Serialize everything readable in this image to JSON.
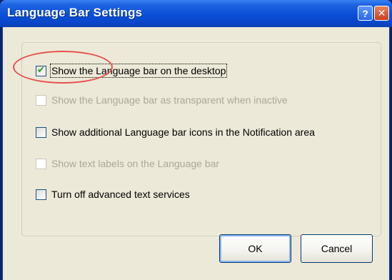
{
  "window": {
    "title": "Language Bar Settings",
    "help_label": "?",
    "close_label": "✕"
  },
  "options": [
    {
      "label": "Show the Language bar on the desktop",
      "checked": true,
      "enabled": true,
      "focused": true
    },
    {
      "label": "Show the Language bar as transparent when inactive",
      "checked": false,
      "enabled": false
    },
    {
      "label": "Show additional Language bar icons in the Notification area",
      "checked": false,
      "enabled": true
    },
    {
      "label": "Show text labels on the Language bar",
      "checked": false,
      "enabled": false
    },
    {
      "label": "Turn off advanced text services",
      "checked": false,
      "enabled": true
    }
  ],
  "buttons": {
    "ok_label": "OK",
    "cancel_label": "Cancel"
  },
  "colors": {
    "titlebar": "#0a4fd6",
    "dialog_background": "#ece9d8",
    "annotation_circle": "#e6504d",
    "checkmark": "#21a121"
  }
}
